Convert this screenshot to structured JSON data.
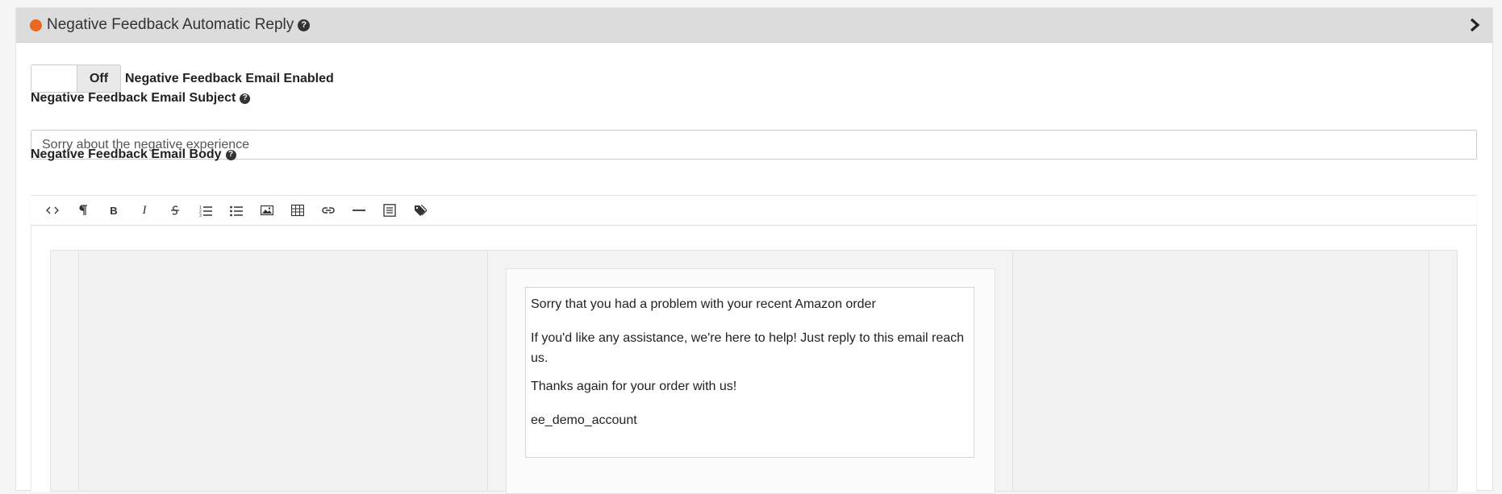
{
  "panel": {
    "title": "Negative Feedback Automatic Reply",
    "status_color": "#e8691e"
  },
  "toggle": {
    "state": "Off",
    "label": "Negative Feedback Email Enabled"
  },
  "subject": {
    "label": "Negative Feedback Email Subject",
    "value": "Sorry about the negative experience"
  },
  "body": {
    "label": "Negative Feedback Email Body",
    "toolbar": [
      "html-icon",
      "paragraph-icon",
      "bold-icon",
      "italic-icon",
      "strikethrough-icon",
      "ordered-list-icon",
      "unordered-list-icon",
      "image-icon",
      "table-icon",
      "link-icon",
      "horizontal-rule-icon",
      "align-icon",
      "tags-icon"
    ],
    "message": {
      "line1": "Sorry that you had a problem with your recent Amazon order",
      "line2": "If you'd like any assistance, we're here to help! Just reply to this email reach us.",
      "line3": "Thanks again for your order with us!",
      "signature": "ee_demo_account"
    }
  }
}
